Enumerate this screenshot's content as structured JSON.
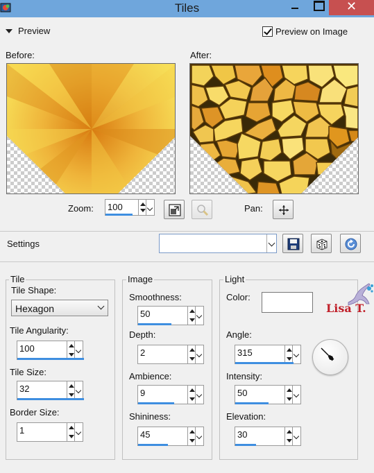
{
  "window": {
    "title": "Tiles",
    "close_glyph": "✕"
  },
  "preview": {
    "section_label": "Preview",
    "preview_on_image_label": "Preview on Image",
    "preview_on_image_checked": true,
    "before_label": "Before:",
    "after_label": "After:",
    "zoom_label": "Zoom:",
    "zoom_value": "100",
    "pan_label": "Pan:"
  },
  "settings": {
    "label": "Settings",
    "preset_value": ""
  },
  "tile": {
    "legend": "Tile",
    "shape_label": "Tile Shape:",
    "shape_value": "Hexagon",
    "angularity_label": "Tile Angularity:",
    "angularity_value": "100",
    "size_label": "Tile Size:",
    "size_value": "32",
    "border_label": "Border Size:",
    "border_value": "1"
  },
  "image": {
    "legend": "Image",
    "smoothness_label": "Smoothness:",
    "smoothness_value": "50",
    "depth_label": "Depth:",
    "depth_value": "2",
    "ambience_label": "Ambience:",
    "ambience_value": "9",
    "shininess_label": "Shininess:",
    "shininess_value": "45"
  },
  "light": {
    "legend": "Light",
    "color_label": "Color:",
    "color_value": "#ffffff",
    "angle_label": "Angle:",
    "angle_value": "315",
    "intensity_label": "Intensity:",
    "intensity_value": "50",
    "elevation_label": "Elevation:",
    "elevation_value": "30"
  },
  "watermark": {
    "text": "Lisa T."
  },
  "colors": {
    "titlebar": "#6fa6dc",
    "close": "#c75050",
    "accent_bar": "#3e8ee0",
    "watermark": "#c0202a"
  }
}
